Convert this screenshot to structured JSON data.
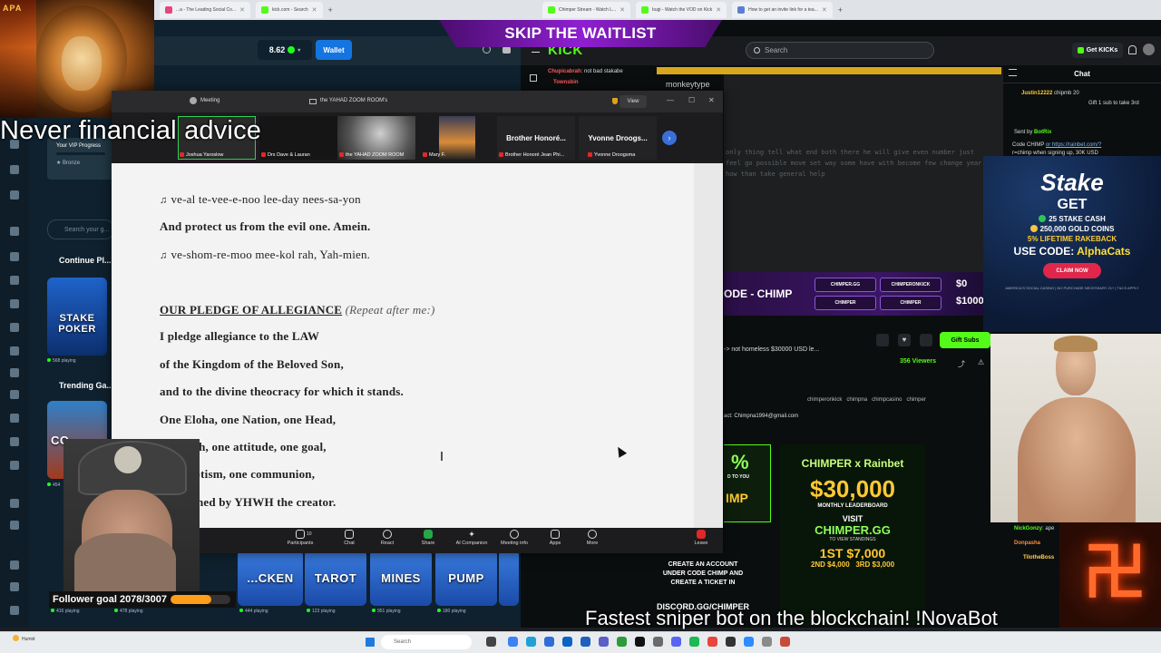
{
  "browser_left": {
    "tabs": [
      "...a - The Leading Social Co...",
      "kick.com - Search"
    ]
  },
  "browser_right": {
    "tabs": [
      "Chimper Stream - Watch L...",
      "bugi - Watch the VOD on Kick",
      "How to get an invite link for a tea..."
    ]
  },
  "overlays": {
    "skip_banner": "SKIP THE WAITLIST",
    "advice": "Never financial advice",
    "sniper": "Fastest sniper bot on the blockchain! !NovaBot",
    "follower_goal": "Follower goal 2078/3007",
    "follower_progress": 0.69,
    "lion_brand": "APA"
  },
  "casino": {
    "balance": "8.62",
    "wallet_label": "Wallet",
    "vip_title": "Your VIP Progress",
    "vip_tier": "Bronze",
    "search_placeholder": "Search your g...",
    "continue_title": "Continue Pl...",
    "trending_title": "Trending Ga...",
    "stake_poker": "STAKE POKER",
    "stake_poker_playing": "568 playing",
    "trending_tile": "CO...",
    "trending_playing": "454",
    "bottom_games": [
      {
        "name": "...CKEN",
        "playing": "444 playing"
      },
      {
        "name": "TAROT",
        "playing": "123 playing"
      },
      {
        "name": "MINES",
        "playing": "951 playing"
      },
      {
        "name": "PUMP",
        "playing": "180 playing"
      }
    ],
    "bottom_playing_left": [
      "416 playing",
      "478 playing"
    ]
  },
  "zoom": {
    "meeting_label": "Meeting",
    "room_title": "the YAHAD ZOOM ROOM's",
    "view_label": "View",
    "participants": [
      {
        "name": "Joshua Yaroslow",
        "tile": ""
      },
      {
        "name": "Drs Dave & Lauran",
        "tile": ""
      },
      {
        "name": "the YAHAD ZOOM ROOM",
        "tile": ""
      },
      {
        "name": "Mary F.",
        "tile": ""
      },
      {
        "name": "Brother Honoré Jean Phi...",
        "tile": "Brother Honoré..."
      },
      {
        "name": "Yvonne Droogsma",
        "tile": "Yvonne Droogs..."
      }
    ],
    "doc_lines": [
      {
        "type": "note",
        "text": "ve-al te-vee-e-noo lee-day nees-sa-yon"
      },
      {
        "type": "bold",
        "text": "And protect us from the evil one. Amein."
      },
      {
        "type": "note",
        "text": "ve-shom-re-moo mee-kol rah, Yah-mien."
      },
      {
        "type": "plain",
        "text": "I pledge allegiance to the LAW"
      },
      {
        "type": "plain",
        "text": "of the Kingdom of the Beloved Son,"
      },
      {
        "type": "plain",
        "text": "and to the divine theocracy for which it stands."
      },
      {
        "type": "plain",
        "text": "One Eloha, one Nation, one Head,"
      },
      {
        "type": "plain",
        "text": "one faith, one attitude, one goal,"
      },
      {
        "type": "plain",
        "text": "one baptism, one communion,"
      },
      {
        "type": "plain",
        "text": "...ordained by YHWH the creator."
      }
    ],
    "pledge_heading": "OUR PLEDGE OF ALLEGIANCE",
    "pledge_note": "(Repeat after me:)",
    "toolbar": {
      "participants": "Participants",
      "participants_count": "10",
      "chat": "Chat",
      "react": "React",
      "share": "Share",
      "ai": "AI Companion",
      "info": "Meeting info",
      "apps": "Apps",
      "more": "More",
      "leave": "Leave"
    }
  },
  "kick": {
    "logo": "KICK",
    "search_placeholder": "Search",
    "get_kicks": "Get KICKs",
    "chat_title": "Chat",
    "chat_top": [
      {
        "user": "Chupicabrah",
        "msg": ": not bad stakabe"
      },
      {
        "user": "Townsbin",
        "msg": ""
      }
    ],
    "chat_lines": [
      {
        "user": "Justin12222",
        "msg": "chipmb  20"
      },
      {
        "user": "",
        "msg": "Gift 1 sub to take 3rd"
      },
      {
        "user": "Sent by",
        "msg": "BotRix"
      },
      {
        "user": "Code CHIMP",
        "msg": "or https://rainbet.com/?"
      },
      {
        "user": "",
        "msg": "r=chimp when signing up, 30K USD"
      }
    ],
    "chat_bottom": [
      {
        "user": "NickGonzy",
        "msg": ": ape"
      },
      {
        "user": "Donpasha",
        "msg": ""
      },
      {
        "user": "TilotheBoss",
        "msg": ""
      }
    ],
    "stream_text": "only thing tell what end both there he will give even number just feel go possible move set way some have with become few change year how than take general help",
    "stream_title": "monkeytype",
    "code_banner": "ODE - CHIMP",
    "banner_badges": [
      {
        "label": "CHIMPER.GG",
        "sub": "LEADERBOARD"
      },
      {
        "label": "CHIMPERONKICK",
        "sub": "X.COM"
      },
      {
        "label": "CHIMPER",
        "sub": "KICK.COM"
      },
      {
        "label": "CHIMPER",
        "sub": "DISCORD.GG"
      }
    ],
    "banner_amounts": [
      "$0",
      "$1000"
    ],
    "stream_name": "-> not homeless $30000 USD le...",
    "viewers": "356 Viewers",
    "gift_subs": "Gift Subs",
    "socials": [
      "chimperonkick",
      "chimpna",
      "chimpcasino",
      "chimper"
    ],
    "contact": "act: Chimpna1994@gmail.com",
    "promo_left": "%",
    "promo_left_small": "D TO YOU",
    "promo_left_label": "IMP",
    "promo": {
      "brand": "CHIMPER x Rainbet",
      "amount": "$30,000",
      "period": "MONTHLY LEADERBOARD",
      "visit": "VISIT",
      "site": "CHIMPER.GG",
      "standings": "TO VIEW STANDINGS",
      "first": "1ST $7,000",
      "second": "2ND $4,000",
      "third": "3RD $3,000"
    },
    "discord": {
      "line1": "CREATE AN ACCOUNT",
      "line2": "UNDER CODE CHIMP AND",
      "line3": "CREATE A TICKET IN",
      "line4": "DISCORD.GG/CHIMPER"
    }
  },
  "stake_ad": {
    "logo": "Stake",
    "get": "GET",
    "cash": "25 STAKE CASH",
    "coins": "250,000 GOLD COINS",
    "rakeback": "5% LIFETIME RAKEBACK",
    "code_prefix": "USE CODE:",
    "code": "AlphaCats",
    "claim": "CLAIM NOW",
    "fineprint": "AMERICA'S SOCIAL CASINO | NO PURCHASE NECESSARY   21+ | T&CS APPLY"
  },
  "taskbar": {
    "weather": "Humid",
    "search": "Search"
  },
  "colors": {
    "kick_green": "#53fc18",
    "stake_blue": "#1475e1",
    "zoom_dark": "#1c1c1e",
    "follower_bar": "#ff9e1b"
  }
}
